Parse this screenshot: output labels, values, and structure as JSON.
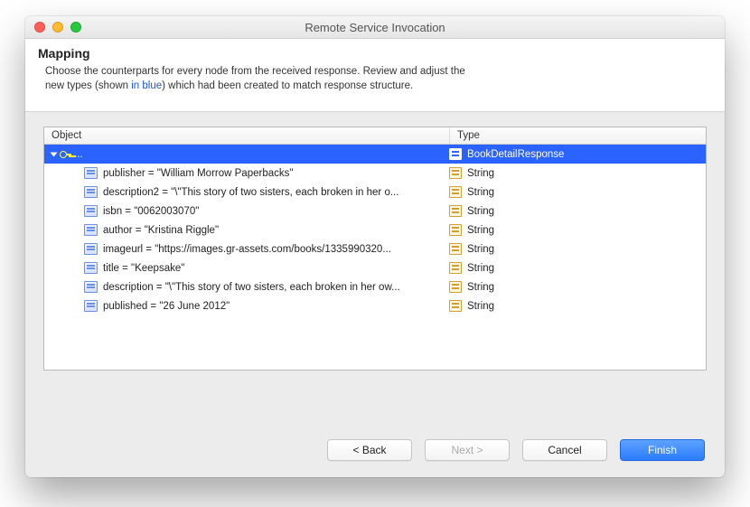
{
  "window": {
    "title": "Remote Service Invocation"
  },
  "header": {
    "title": "Mapping",
    "line1_a": "Choose the counterparts for every node from the received response. Review and adjust the",
    "line2_a": "new types (shown ",
    "line2_blue": "in blue",
    "line2_b": ") which had been created to match response structure."
  },
  "columns": {
    "object": "Object",
    "type": "Type"
  },
  "root": {
    "label": "...",
    "type": "BookDetailResponse"
  },
  "rows": [
    {
      "field": "publisher",
      "value": "\"William Morrow Paperbacks\"",
      "type": "String"
    },
    {
      "field": "description2",
      "value": "\"\\\"This story of two sisters, each broken in her o...",
      "type": "String"
    },
    {
      "field": "isbn",
      "value": "\"0062003070\"",
      "type": "String"
    },
    {
      "field": "author",
      "value": "\"Kristina Riggle\"",
      "type": "String"
    },
    {
      "field": "imageurl",
      "value": "\"https://images.gr-assets.com/books/1335990320...",
      "type": "String"
    },
    {
      "field": "title",
      "value": "\"Keepsake\"",
      "type": "String"
    },
    {
      "field": "description",
      "value": "\"\\\"This story of two sisters, each broken in her ow...",
      "type": "String"
    },
    {
      "field": "published",
      "value": "\"26 June 2012\"",
      "type": "String"
    }
  ],
  "buttons": {
    "back": "< Back",
    "next": "Next >",
    "cancel": "Cancel",
    "finish": "Finish"
  }
}
